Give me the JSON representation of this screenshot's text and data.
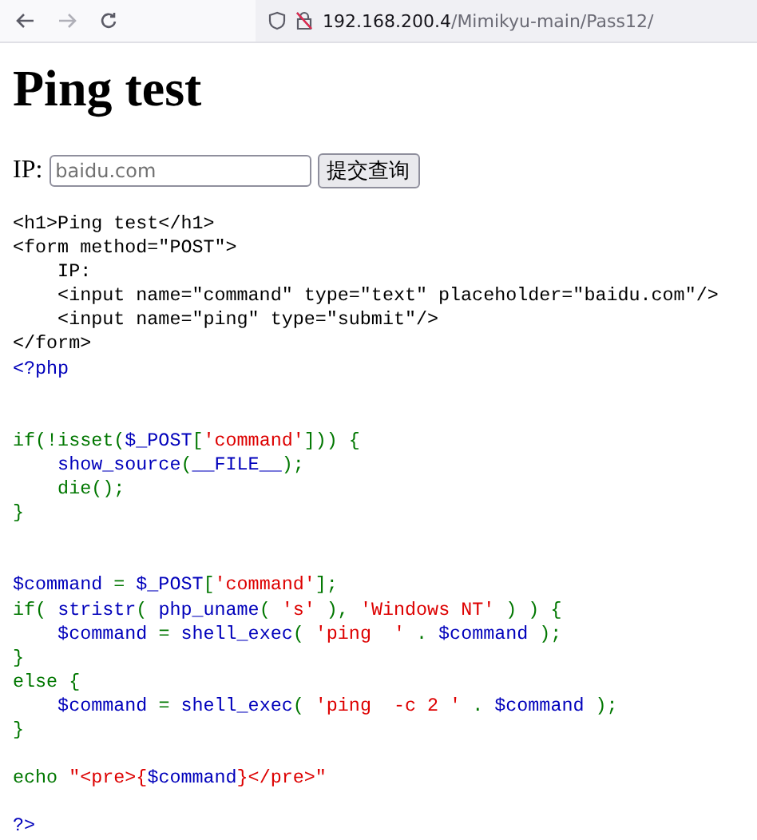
{
  "browser": {
    "url_host": "192.168.200.4",
    "url_path": "/Mimikyu-main/Pass12/"
  },
  "heading": "Ping test",
  "form": {
    "label": "IP:",
    "placeholder": "baidu.com",
    "button": "提交查询"
  },
  "code": [
    {
      "kind": "code",
      "segments": [
        {
          "kind": "html",
          "text": "<h1>Ping test</h1>"
        }
      ]
    },
    {
      "kind": "code",
      "segments": [
        {
          "kind": "html",
          "text": "<form method=\"POST\">"
        }
      ]
    },
    {
      "kind": "code",
      "segments": [
        {
          "kind": "html",
          "text": "    IP:"
        }
      ]
    },
    {
      "kind": "code",
      "segments": [
        {
          "kind": "html",
          "text": "    <input name=\"command\" type=\"text\" placeholder=\"baidu.com\"/>"
        }
      ]
    },
    {
      "kind": "code",
      "segments": [
        {
          "kind": "html",
          "text": "    <input name=\"ping\" type=\"submit\"/>"
        }
      ]
    },
    {
      "kind": "code",
      "segments": [
        {
          "kind": "html",
          "text": "</form>"
        }
      ]
    },
    {
      "kind": "code",
      "segments": [
        {
          "kind": "default",
          "text": "<?php"
        }
      ]
    },
    {
      "kind": "blank"
    },
    {
      "kind": "blank"
    },
    {
      "kind": "code",
      "segments": [
        {
          "kind": "keyword",
          "text": "if(!isset("
        },
        {
          "kind": "default",
          "text": "$_POST"
        },
        {
          "kind": "keyword",
          "text": "["
        },
        {
          "kind": "string",
          "text": "'command'"
        },
        {
          "kind": "keyword",
          "text": "])) {"
        }
      ]
    },
    {
      "kind": "code",
      "segments": [
        {
          "kind": "default",
          "text": "    show_source"
        },
        {
          "kind": "keyword",
          "text": "("
        },
        {
          "kind": "default",
          "text": "__FILE__"
        },
        {
          "kind": "keyword",
          "text": ");"
        }
      ]
    },
    {
      "kind": "code",
      "segments": [
        {
          "kind": "keyword",
          "text": "    die();"
        }
      ]
    },
    {
      "kind": "code",
      "segments": [
        {
          "kind": "keyword",
          "text": "}"
        }
      ]
    },
    {
      "kind": "blank"
    },
    {
      "kind": "blank"
    },
    {
      "kind": "code",
      "segments": [
        {
          "kind": "default",
          "text": "$command"
        },
        {
          "kind": "keyword",
          "text": " = "
        },
        {
          "kind": "default",
          "text": "$_POST"
        },
        {
          "kind": "keyword",
          "text": "["
        },
        {
          "kind": "string",
          "text": "'command'"
        },
        {
          "kind": "keyword",
          "text": "];"
        }
      ]
    },
    {
      "kind": "code",
      "segments": [
        {
          "kind": "keyword",
          "text": "if( "
        },
        {
          "kind": "default",
          "text": "stristr"
        },
        {
          "kind": "keyword",
          "text": "( "
        },
        {
          "kind": "default",
          "text": "php_uname"
        },
        {
          "kind": "keyword",
          "text": "( "
        },
        {
          "kind": "string",
          "text": "'s'"
        },
        {
          "kind": "keyword",
          "text": " ), "
        },
        {
          "kind": "string",
          "text": "'Windows NT'"
        },
        {
          "kind": "keyword",
          "text": " ) ) {"
        }
      ]
    },
    {
      "kind": "code",
      "segments": [
        {
          "kind": "default",
          "text": "    $command "
        },
        {
          "kind": "keyword",
          "text": "= "
        },
        {
          "kind": "default",
          "text": "shell_exec"
        },
        {
          "kind": "keyword",
          "text": "( "
        },
        {
          "kind": "string",
          "text": "'ping  '"
        },
        {
          "kind": "keyword",
          "text": " . "
        },
        {
          "kind": "default",
          "text": "$command"
        },
        {
          "kind": "keyword",
          "text": " );"
        }
      ]
    },
    {
      "kind": "code",
      "segments": [
        {
          "kind": "keyword",
          "text": "}"
        }
      ]
    },
    {
      "kind": "code",
      "segments": [
        {
          "kind": "keyword",
          "text": "else {"
        }
      ]
    },
    {
      "kind": "code",
      "segments": [
        {
          "kind": "default",
          "text": "    $command "
        },
        {
          "kind": "keyword",
          "text": "= "
        },
        {
          "kind": "default",
          "text": "shell_exec"
        },
        {
          "kind": "keyword",
          "text": "( "
        },
        {
          "kind": "string",
          "text": "'ping  -c 2 '"
        },
        {
          "kind": "keyword",
          "text": " . "
        },
        {
          "kind": "default",
          "text": "$command"
        },
        {
          "kind": "keyword",
          "text": " );"
        }
      ]
    },
    {
      "kind": "code",
      "segments": [
        {
          "kind": "keyword",
          "text": "}"
        }
      ]
    },
    {
      "kind": "blank"
    },
    {
      "kind": "code",
      "segments": [
        {
          "kind": "keyword",
          "text": "echo "
        },
        {
          "kind": "string",
          "text": "\"<pre>{"
        },
        {
          "kind": "default",
          "text": "$command"
        },
        {
          "kind": "string",
          "text": "}</pre>\""
        }
      ]
    },
    {
      "kind": "blank"
    },
    {
      "kind": "code",
      "segments": [
        {
          "kind": "default",
          "text": "?>"
        }
      ]
    }
  ]
}
